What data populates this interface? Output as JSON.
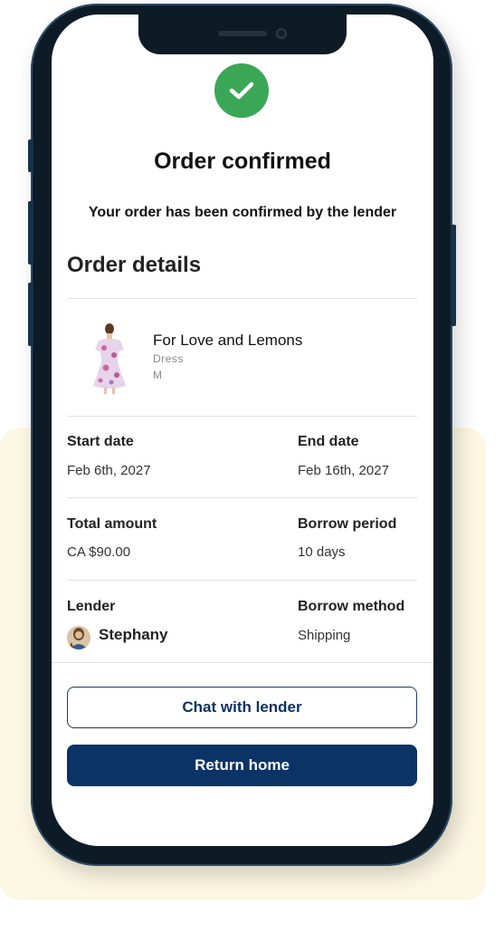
{
  "colors": {
    "primary": "#0b3366",
    "success": "#3aa757",
    "background_panel": "#fdf8e3"
  },
  "icons": {
    "status": "check-icon",
    "product": "dress-thumbnail",
    "lender_avatar": "avatar-image"
  },
  "header": {
    "title": "Order confirmed",
    "subtitle": "Your order has been confirmed by the lender"
  },
  "order": {
    "section_title": "Order details",
    "product": {
      "name": "For Love and Lemons",
      "category": "Dress",
      "size": "M"
    },
    "start_date_label": "Start date",
    "start_date": "Feb 6th, 2027",
    "end_date_label": "End date",
    "end_date": "Feb 16th, 2027",
    "total_label": "Total amount",
    "total": "CA $90.00",
    "period_label": "Borrow period",
    "period": "10 days",
    "lender_label": "Lender",
    "lender_name": "Stephany",
    "method_label": "Borrow method",
    "method": "Shipping"
  },
  "actions": {
    "chat_label": "Chat with lender",
    "home_label": "Return home"
  }
}
